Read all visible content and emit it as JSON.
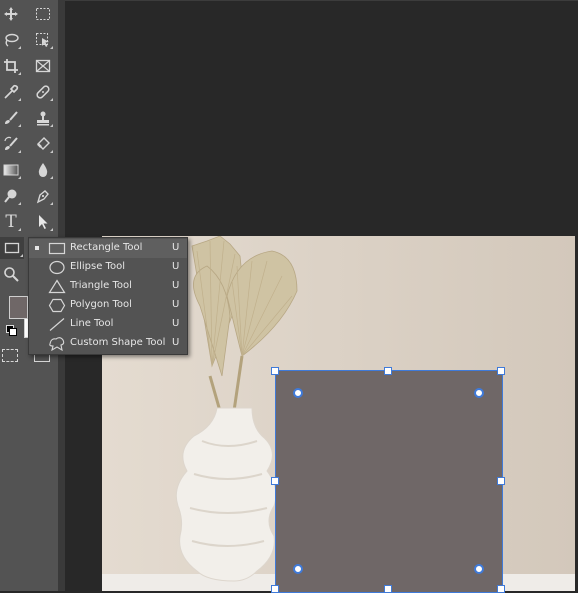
{
  "toolbar": {
    "tools": [
      {
        "name": "move-tool",
        "icon": "move-icon"
      },
      {
        "name": "rectangular-marquee-tool",
        "icon": "marquee-icon"
      },
      {
        "name": "lasso-tool",
        "icon": "lasso-icon"
      },
      {
        "name": "object-selection-tool",
        "icon": "object-select-icon"
      },
      {
        "name": "crop-tool",
        "icon": "crop-icon"
      },
      {
        "name": "frame-tool",
        "icon": "frame-icon"
      },
      {
        "name": "eyedropper-tool",
        "icon": "eyedropper-icon"
      },
      {
        "name": "healing-brush-tool",
        "icon": "bandage-icon"
      },
      {
        "name": "brush-tool",
        "icon": "brush-icon"
      },
      {
        "name": "clone-stamp-tool",
        "icon": "stamp-icon"
      },
      {
        "name": "history-brush-tool",
        "icon": "history-brush-icon"
      },
      {
        "name": "eraser-tool",
        "icon": "eraser-icon"
      },
      {
        "name": "gradient-tool",
        "icon": "gradient-icon"
      },
      {
        "name": "blur-tool",
        "icon": "drop-icon"
      },
      {
        "name": "dodge-tool",
        "icon": "dodge-icon"
      },
      {
        "name": "pen-tool",
        "icon": "pen-icon"
      },
      {
        "name": "type-tool",
        "icon": "type-icon"
      },
      {
        "name": "path-selection-tool",
        "icon": "arrow-icon"
      },
      {
        "name": "rectangle-tool",
        "icon": "rectangle-icon"
      },
      {
        "name": "zoom-tool",
        "icon": "zoom-icon"
      }
    ],
    "type_glyph": "T",
    "foreground_color": "#6f6767",
    "background_color": "#ffffff"
  },
  "shape_flyout": {
    "items": [
      {
        "label": "Rectangle Tool",
        "shortcut": "U",
        "icon": "rectangle-icon",
        "selected": true
      },
      {
        "label": "Ellipse Tool",
        "shortcut": "U",
        "icon": "ellipse-icon",
        "selected": false
      },
      {
        "label": "Triangle Tool",
        "shortcut": "U",
        "icon": "triangle-icon",
        "selected": false
      },
      {
        "label": "Polygon Tool",
        "shortcut": "U",
        "icon": "polygon-icon",
        "selected": false
      },
      {
        "label": "Line Tool",
        "shortcut": "U",
        "icon": "line-icon",
        "selected": false
      },
      {
        "label": "Custom Shape Tool",
        "shortcut": "U",
        "icon": "custom-shape-icon",
        "selected": false
      }
    ]
  },
  "document": {
    "background_color": "#ddd2c6",
    "shape_fill": "#6f6767",
    "handle_color": "#3f7ad9"
  }
}
